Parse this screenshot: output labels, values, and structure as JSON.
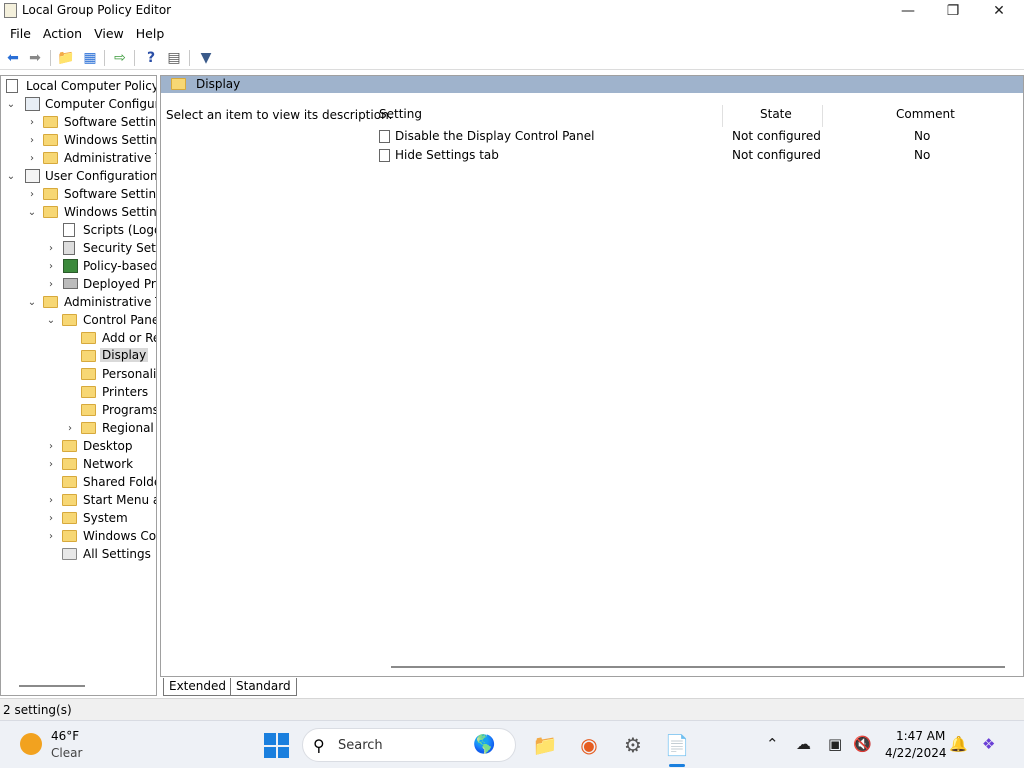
{
  "window": {
    "title": "Local Group Policy Editor"
  },
  "menu": [
    "File",
    "Action",
    "View",
    "Help"
  ],
  "tree": {
    "root": "Local Computer Policy",
    "computer_config": "Computer Configura",
    "cc_software": "Software Settings",
    "cc_windows": "Windows Setting",
    "cc_admin": "Administrative Te",
    "user_config": "User Configuration",
    "uc_software": "Software Settings",
    "uc_windows": "Windows Setting",
    "scripts": "Scripts (Logon",
    "security": "Security Settin",
    "policy_based": "Policy-based",
    "deployed": "Deployed Prin",
    "uc_admin": "Administrative Te",
    "control_panel": "Control Panel",
    "add_remove": "Add or Re",
    "display": "Display",
    "personalization": "Personaliz",
    "printers": "Printers",
    "programs": "Programs",
    "regional": "Regional a",
    "desktop": "Desktop",
    "network": "Network",
    "shared_folders": "Shared Folder",
    "start_menu": "Start Menu ar",
    "system": "System",
    "windows_comp": "Windows Cor",
    "all_settings": "All Settings"
  },
  "content": {
    "header": "Display",
    "description": "Select an item to view its description.",
    "columns": {
      "setting": "Setting",
      "state": "State",
      "comment": "Comment"
    },
    "rows": [
      {
        "setting": "Disable the Display Control Panel",
        "state": "Not configured",
        "comment": "No"
      },
      {
        "setting": "Hide Settings tab",
        "state": "Not configured",
        "comment": "No"
      }
    ]
  },
  "tabs": [
    "Extended",
    "Standard"
  ],
  "status": "2 setting(s)",
  "taskbar": {
    "temp": "46°F",
    "condition": "Clear",
    "search": "Search",
    "time": "1:47 AM",
    "date": "4/22/2024"
  }
}
